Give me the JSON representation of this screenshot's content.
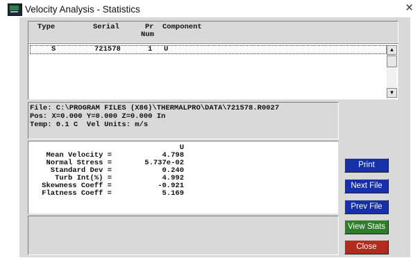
{
  "window": {
    "title": "Velocity Analysis - Statistics",
    "close_glyph": "×"
  },
  "table": {
    "headers": {
      "type": "Type",
      "serial": "Serial",
      "pr_line1": "Pr",
      "pr_line2": "Num",
      "component": "Component"
    },
    "rows": [
      {
        "type": "S",
        "serial": "721578",
        "pr_num": "1",
        "component": "U"
      }
    ],
    "scroll_up": "▲",
    "scroll_down": "▼"
  },
  "file_info": {
    "line1": "File: C:\\PROGRAM FILES (X86)\\THERMALPRO\\DATA\\721578.R0027",
    "line2": "Pos: X=0.000 Y=0.000 Z=0.000 In",
    "line3": "Temp: 0.1 C  Vel Units: m/s"
  },
  "stats": {
    "column_header": "U",
    "rows": [
      {
        "label": "Mean Velocity =",
        "value": "4.798"
      },
      {
        "label": "Normal Stress =",
        "value": "5.737e-02"
      },
      {
        "label": "Standard Dev =",
        "value": "0.240"
      },
      {
        "label": "Turb Int(%) =",
        "value": "4.992"
      },
      {
        "label": "Skewness Coeff =",
        "value": "-0.921"
      },
      {
        "label": "Flatness Coeff =",
        "value": "5.169"
      }
    ]
  },
  "buttons": {
    "print": "Print",
    "next_file": "Next File",
    "prev_file": "Prev File",
    "view_stats": "View Stats",
    "close": "Close"
  },
  "colors": {
    "button_blue": "#1730a8",
    "button_green": "#2f7d2a",
    "button_red": "#b52a1e",
    "panel_gray": "#d9d9d9"
  }
}
